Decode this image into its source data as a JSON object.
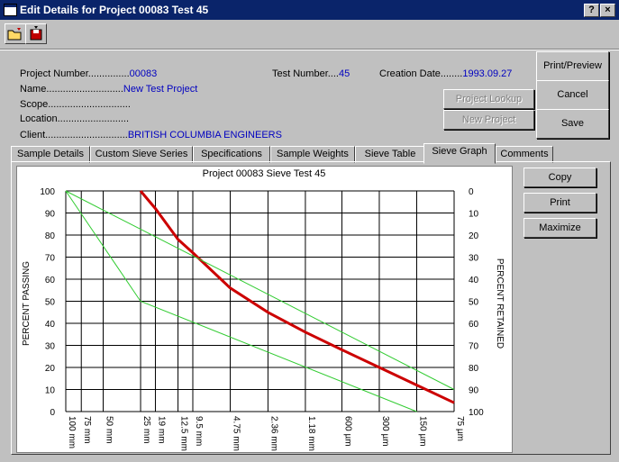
{
  "window": {
    "title": "Edit Details for Project 00083 Test 45",
    "help": "?",
    "close": "×"
  },
  "fields": {
    "project_number_label": "Project Number...............",
    "project_number": "00083",
    "name_label": "Name............................",
    "name": "New Test Project",
    "scope_label": "Scope..............................",
    "location_label": "Location..........................",
    "client_label": "Client..............................",
    "client": "BRITISH COLUMBIA ENGINEERS",
    "test_number_label": "Test Number....",
    "test_number": "45",
    "creation_date_label": "Creation Date........",
    "creation_date": "1993.09.27"
  },
  "buttons": {
    "print_preview": "Print/Preview",
    "cancel": "Cancel",
    "save": "Save",
    "project_lookup": "Project Lookup",
    "new_project": "New Project",
    "copy": "Copy",
    "print": "Print",
    "maximize": "Maximize"
  },
  "tabs": [
    "Sample Details",
    "Custom Sieve Series",
    "Specifications",
    "Sample Weights",
    "Sieve Table",
    "Sieve Graph",
    "Comments"
  ],
  "active_tab": "Sieve Graph",
  "colors": {
    "titlebar": "#0a246a",
    "value_text": "#0000c0",
    "curve": "#cc0000",
    "spec": "#33cc33"
  },
  "chart_data": {
    "type": "line",
    "title": "Project 00083 Sieve Test 45",
    "ylabel": "PERCENT PASSING",
    "ylabel_right": "PERCENT RETAINED",
    "ylim": [
      0,
      100
    ],
    "yticks": [
      100,
      90,
      80,
      70,
      60,
      50,
      40,
      30,
      20,
      10,
      0
    ],
    "yticks_right": [
      0,
      10,
      20,
      30,
      40,
      50,
      60,
      70,
      80,
      90,
      100
    ],
    "x_scale": "log (sieve opening)",
    "x_ticks_mm": [
      100,
      75,
      50,
      25,
      19,
      12.5,
      9.5,
      4.75,
      2.36,
      1.18,
      0.6,
      0.3,
      0.15,
      0.075
    ],
    "x_tick_labels": [
      "100 mm",
      "75 mm",
      "50 mm",
      "25 mm",
      "19 mm",
      "12.5 mm",
      "9.5 mm",
      "4.75 mm",
      "2.36 mm",
      "1.18 mm",
      "600 µm",
      "300 µm",
      "150 µm",
      "75 µm"
    ],
    "series": [
      {
        "x": [
          25,
          19,
          12.5,
          9.5,
          4.75,
          2.36,
          1.18,
          0.6,
          0.3,
          0.15,
          0.075
        ],
        "values": [
          100,
          92,
          78,
          72,
          56,
          45,
          36,
          28,
          20,
          12,
          4
        ],
        "color": "#cc0000"
      },
      {
        "x": [
          100,
          0.075
        ],
        "values": [
          100,
          10
        ],
        "color": "#33cc33"
      },
      {
        "x": [
          100,
          25,
          0.15
        ],
        "values": [
          100,
          50,
          0
        ],
        "color": "#33cc33"
      }
    ]
  }
}
